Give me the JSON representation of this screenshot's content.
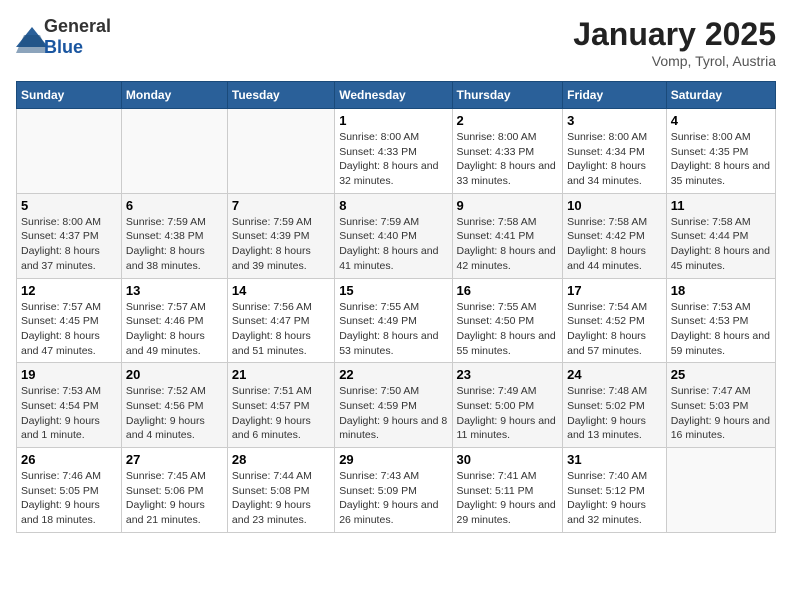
{
  "logo": {
    "general": "General",
    "blue": "Blue"
  },
  "title": "January 2025",
  "subtitle": "Vomp, Tyrol, Austria",
  "days_of_week": [
    "Sunday",
    "Monday",
    "Tuesday",
    "Wednesday",
    "Thursday",
    "Friday",
    "Saturday"
  ],
  "weeks": [
    [
      {
        "day": "",
        "info": ""
      },
      {
        "day": "",
        "info": ""
      },
      {
        "day": "",
        "info": ""
      },
      {
        "day": "1",
        "info": "Sunrise: 8:00 AM\nSunset: 4:33 PM\nDaylight: 8 hours and 32 minutes."
      },
      {
        "day": "2",
        "info": "Sunrise: 8:00 AM\nSunset: 4:33 PM\nDaylight: 8 hours and 33 minutes."
      },
      {
        "day": "3",
        "info": "Sunrise: 8:00 AM\nSunset: 4:34 PM\nDaylight: 8 hours and 34 minutes."
      },
      {
        "day": "4",
        "info": "Sunrise: 8:00 AM\nSunset: 4:35 PM\nDaylight: 8 hours and 35 minutes."
      }
    ],
    [
      {
        "day": "5",
        "info": "Sunrise: 8:00 AM\nSunset: 4:37 PM\nDaylight: 8 hours and 37 minutes."
      },
      {
        "day": "6",
        "info": "Sunrise: 7:59 AM\nSunset: 4:38 PM\nDaylight: 8 hours and 38 minutes."
      },
      {
        "day": "7",
        "info": "Sunrise: 7:59 AM\nSunset: 4:39 PM\nDaylight: 8 hours and 39 minutes."
      },
      {
        "day": "8",
        "info": "Sunrise: 7:59 AM\nSunset: 4:40 PM\nDaylight: 8 hours and 41 minutes."
      },
      {
        "day": "9",
        "info": "Sunrise: 7:58 AM\nSunset: 4:41 PM\nDaylight: 8 hours and 42 minutes."
      },
      {
        "day": "10",
        "info": "Sunrise: 7:58 AM\nSunset: 4:42 PM\nDaylight: 8 hours and 44 minutes."
      },
      {
        "day": "11",
        "info": "Sunrise: 7:58 AM\nSunset: 4:44 PM\nDaylight: 8 hours and 45 minutes."
      }
    ],
    [
      {
        "day": "12",
        "info": "Sunrise: 7:57 AM\nSunset: 4:45 PM\nDaylight: 8 hours and 47 minutes."
      },
      {
        "day": "13",
        "info": "Sunrise: 7:57 AM\nSunset: 4:46 PM\nDaylight: 8 hours and 49 minutes."
      },
      {
        "day": "14",
        "info": "Sunrise: 7:56 AM\nSunset: 4:47 PM\nDaylight: 8 hours and 51 minutes."
      },
      {
        "day": "15",
        "info": "Sunrise: 7:55 AM\nSunset: 4:49 PM\nDaylight: 8 hours and 53 minutes."
      },
      {
        "day": "16",
        "info": "Sunrise: 7:55 AM\nSunset: 4:50 PM\nDaylight: 8 hours and 55 minutes."
      },
      {
        "day": "17",
        "info": "Sunrise: 7:54 AM\nSunset: 4:52 PM\nDaylight: 8 hours and 57 minutes."
      },
      {
        "day": "18",
        "info": "Sunrise: 7:53 AM\nSunset: 4:53 PM\nDaylight: 8 hours and 59 minutes."
      }
    ],
    [
      {
        "day": "19",
        "info": "Sunrise: 7:53 AM\nSunset: 4:54 PM\nDaylight: 9 hours and 1 minute."
      },
      {
        "day": "20",
        "info": "Sunrise: 7:52 AM\nSunset: 4:56 PM\nDaylight: 9 hours and 4 minutes."
      },
      {
        "day": "21",
        "info": "Sunrise: 7:51 AM\nSunset: 4:57 PM\nDaylight: 9 hours and 6 minutes."
      },
      {
        "day": "22",
        "info": "Sunrise: 7:50 AM\nSunset: 4:59 PM\nDaylight: 9 hours and 8 minutes."
      },
      {
        "day": "23",
        "info": "Sunrise: 7:49 AM\nSunset: 5:00 PM\nDaylight: 9 hours and 11 minutes."
      },
      {
        "day": "24",
        "info": "Sunrise: 7:48 AM\nSunset: 5:02 PM\nDaylight: 9 hours and 13 minutes."
      },
      {
        "day": "25",
        "info": "Sunrise: 7:47 AM\nSunset: 5:03 PM\nDaylight: 9 hours and 16 minutes."
      }
    ],
    [
      {
        "day": "26",
        "info": "Sunrise: 7:46 AM\nSunset: 5:05 PM\nDaylight: 9 hours and 18 minutes."
      },
      {
        "day": "27",
        "info": "Sunrise: 7:45 AM\nSunset: 5:06 PM\nDaylight: 9 hours and 21 minutes."
      },
      {
        "day": "28",
        "info": "Sunrise: 7:44 AM\nSunset: 5:08 PM\nDaylight: 9 hours and 23 minutes."
      },
      {
        "day": "29",
        "info": "Sunrise: 7:43 AM\nSunset: 5:09 PM\nDaylight: 9 hours and 26 minutes."
      },
      {
        "day": "30",
        "info": "Sunrise: 7:41 AM\nSunset: 5:11 PM\nDaylight: 9 hours and 29 minutes."
      },
      {
        "day": "31",
        "info": "Sunrise: 7:40 AM\nSunset: 5:12 PM\nDaylight: 9 hours and 32 minutes."
      },
      {
        "day": "",
        "info": ""
      }
    ]
  ]
}
